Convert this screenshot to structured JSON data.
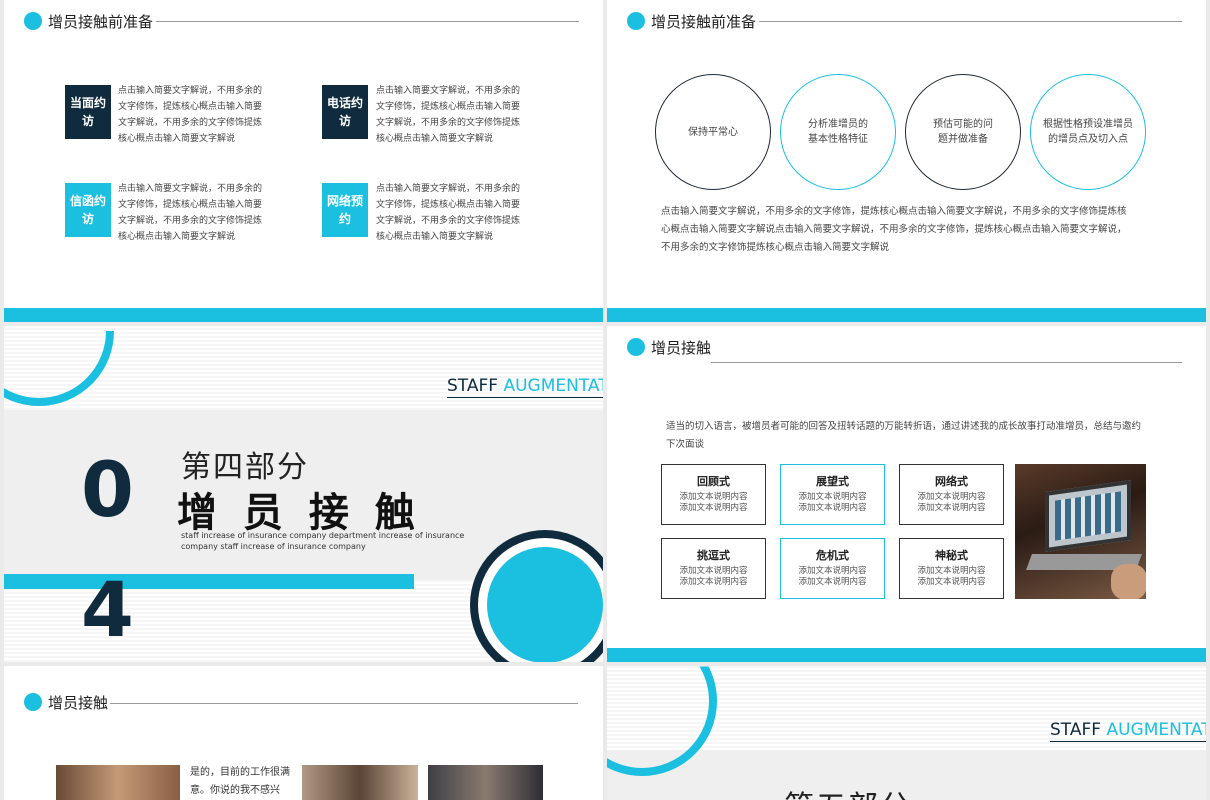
{
  "slide1": {
    "title": "增员接触前准备",
    "items": [
      {
        "tag": "当面约访",
        "text": "点击输入简要文字解说，不用多余的文字修饰，提炼核心概点击输入简要文字解说，不用多余的文字修饰提炼核心概点击输入简要文字解说"
      },
      {
        "tag": "电话约访",
        "text": "点击输入简要文字解说，不用多余的文字修饰，提炼核心概点击输入简要文字解说，不用多余的文字修饰提炼核心概点击输入简要文字解说"
      },
      {
        "tag": "信函约访",
        "text": "点击输入简要文字解说，不用多余的文字修饰，提炼核心概点击输入简要文字解说，不用多余的文字修饰提炼核心概点击输入简要文字解说"
      },
      {
        "tag": "网络预约",
        "text": "点击输入简要文字解说，不用多余的文字修饰，提炼核心概点击输入简要文字解说，不用多余的文字修饰提炼核心概点击输入简要文字解说"
      }
    ]
  },
  "slide2": {
    "title": "增员接触前准备",
    "circles": [
      "保持平常心",
      "分析准增员的基本性格特征",
      "预估可能的问题并做准备",
      "根据性格预设准增员的增员点及切入点"
    ],
    "paragraph": "点击输入简要文字解说，不用多余的文字修饰，提炼核心概点击输入简要文字解说，不用多余的文字修饰提炼核心概点击输入简要文字解说点击输入简要文字解说，不用多余的文字修饰，提炼核心概点击输入简要文字解说，不用多余的文字修饰提炼核心概点击输入简要文字解说"
  },
  "slide3": {
    "brand_a": "STAFF ",
    "brand_b": "AUGMENTAT",
    "part": "第四部分",
    "title": "增 员 接 触",
    "num_top": "0",
    "num_bottom": "4",
    "subtitle": "staff increase of insurance company department increase of insurance company staff increase of insurance company"
  },
  "slide4": {
    "title": "增员接触",
    "intro": "适当的切入语言，被增员者可能的回答及扭转话题的万能转折语，通过讲述我的成长故事打动准增员，总结与邀约下次面谈",
    "boxes": [
      {
        "title": "回顾式",
        "l1": "添加文本说明内容",
        "l2": "添加文本说明内容"
      },
      {
        "title": "展望式",
        "l1": "添加文本说明内容",
        "l2": "添加文本说明内容"
      },
      {
        "title": "网络式",
        "l1": "添加文本说明内容",
        "l2": "添加文本说明内容"
      },
      {
        "title": "挑逗式",
        "l1": "添加文本说明内容",
        "l2": "添加文本说明内容"
      },
      {
        "title": "危机式",
        "l1": "添加文本说明内容",
        "l2": "添加文本说明内容"
      },
      {
        "title": "神秘式",
        "l1": "添加文本说明内容",
        "l2": "添加文本说明内容"
      }
    ]
  },
  "slide5": {
    "title": "增员接触",
    "quote": "是的，目前的工作很满意。你说的我不感兴趣。"
  },
  "slide6": {
    "brand_a": "STAFF ",
    "brand_b": "AUGMENTAT",
    "part": "第五部分"
  },
  "colors": {
    "accent": "#1bbfe0",
    "dark": "#0f2b3d"
  }
}
